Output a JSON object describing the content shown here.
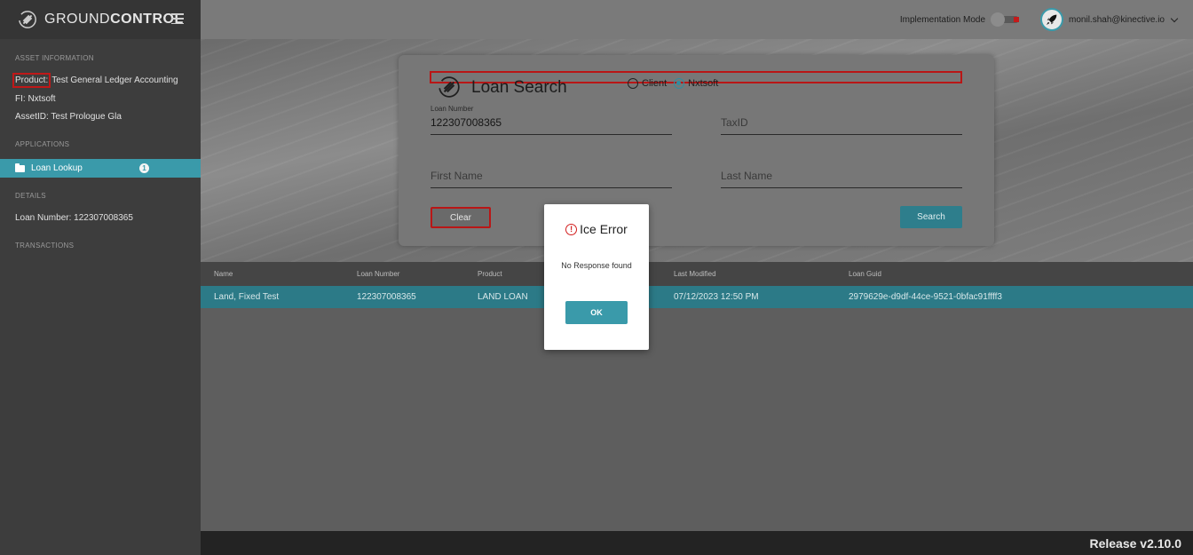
{
  "brand": {
    "prefix": "GROUND",
    "suffix": "CONTROL"
  },
  "sidebar": {
    "asset_header": "ASSET INFORMATION",
    "product_key": "Product:",
    "product_value": "Test General Ledger Accounting",
    "fi_key": "FI:",
    "fi_value": "Nxtsoft",
    "assetid_key": "AssetID:",
    "assetid_value": "Test Prologue Gla",
    "applications_header": "APPLICATIONS",
    "nav_item": "Loan Lookup",
    "nav_badge": "1",
    "details_header": "DETAILS",
    "loan_number_key": "Loan Number:",
    "loan_number_value": "122307008365",
    "transactions_header": "TRANSACTIONS"
  },
  "topbar": {
    "implementation_mode_label": "Implementation Mode",
    "user_email": "monil.shah@kinective.io"
  },
  "search_card": {
    "title": "Loan Search",
    "radio_client": "Client",
    "radio_nxtsoft": "Nxtsoft",
    "selected_radio": "Nxtsoft",
    "loan_number_label": "Loan Number",
    "loan_number_value": "122307008365",
    "taxid_placeholder": "TaxID",
    "first_name_placeholder": "First Name",
    "last_name_placeholder": "Last Name",
    "clear_label": "Clear",
    "search_label": "Search"
  },
  "table": {
    "headers": [
      "Name",
      "Loan Number",
      "Product",
      "Last Modified",
      "Loan Guid"
    ],
    "rows": [
      {
        "name": "Land, Fixed Test",
        "loan_number": "122307008365",
        "product": "LAND LOAN",
        "last_modified": "07/12/2023 12:50 PM",
        "loan_guid": "2979629e-d9df-44ce-9521-0bfac91ffff3"
      }
    ]
  },
  "dialog": {
    "title": "Ice Error",
    "message": "No Response found",
    "ok_label": "OK"
  },
  "footer": {
    "release": "Release v2.10.0"
  },
  "colors": {
    "accent": "#3a9aaa",
    "error": "#d21e1e",
    "highlight": "#b91616"
  }
}
